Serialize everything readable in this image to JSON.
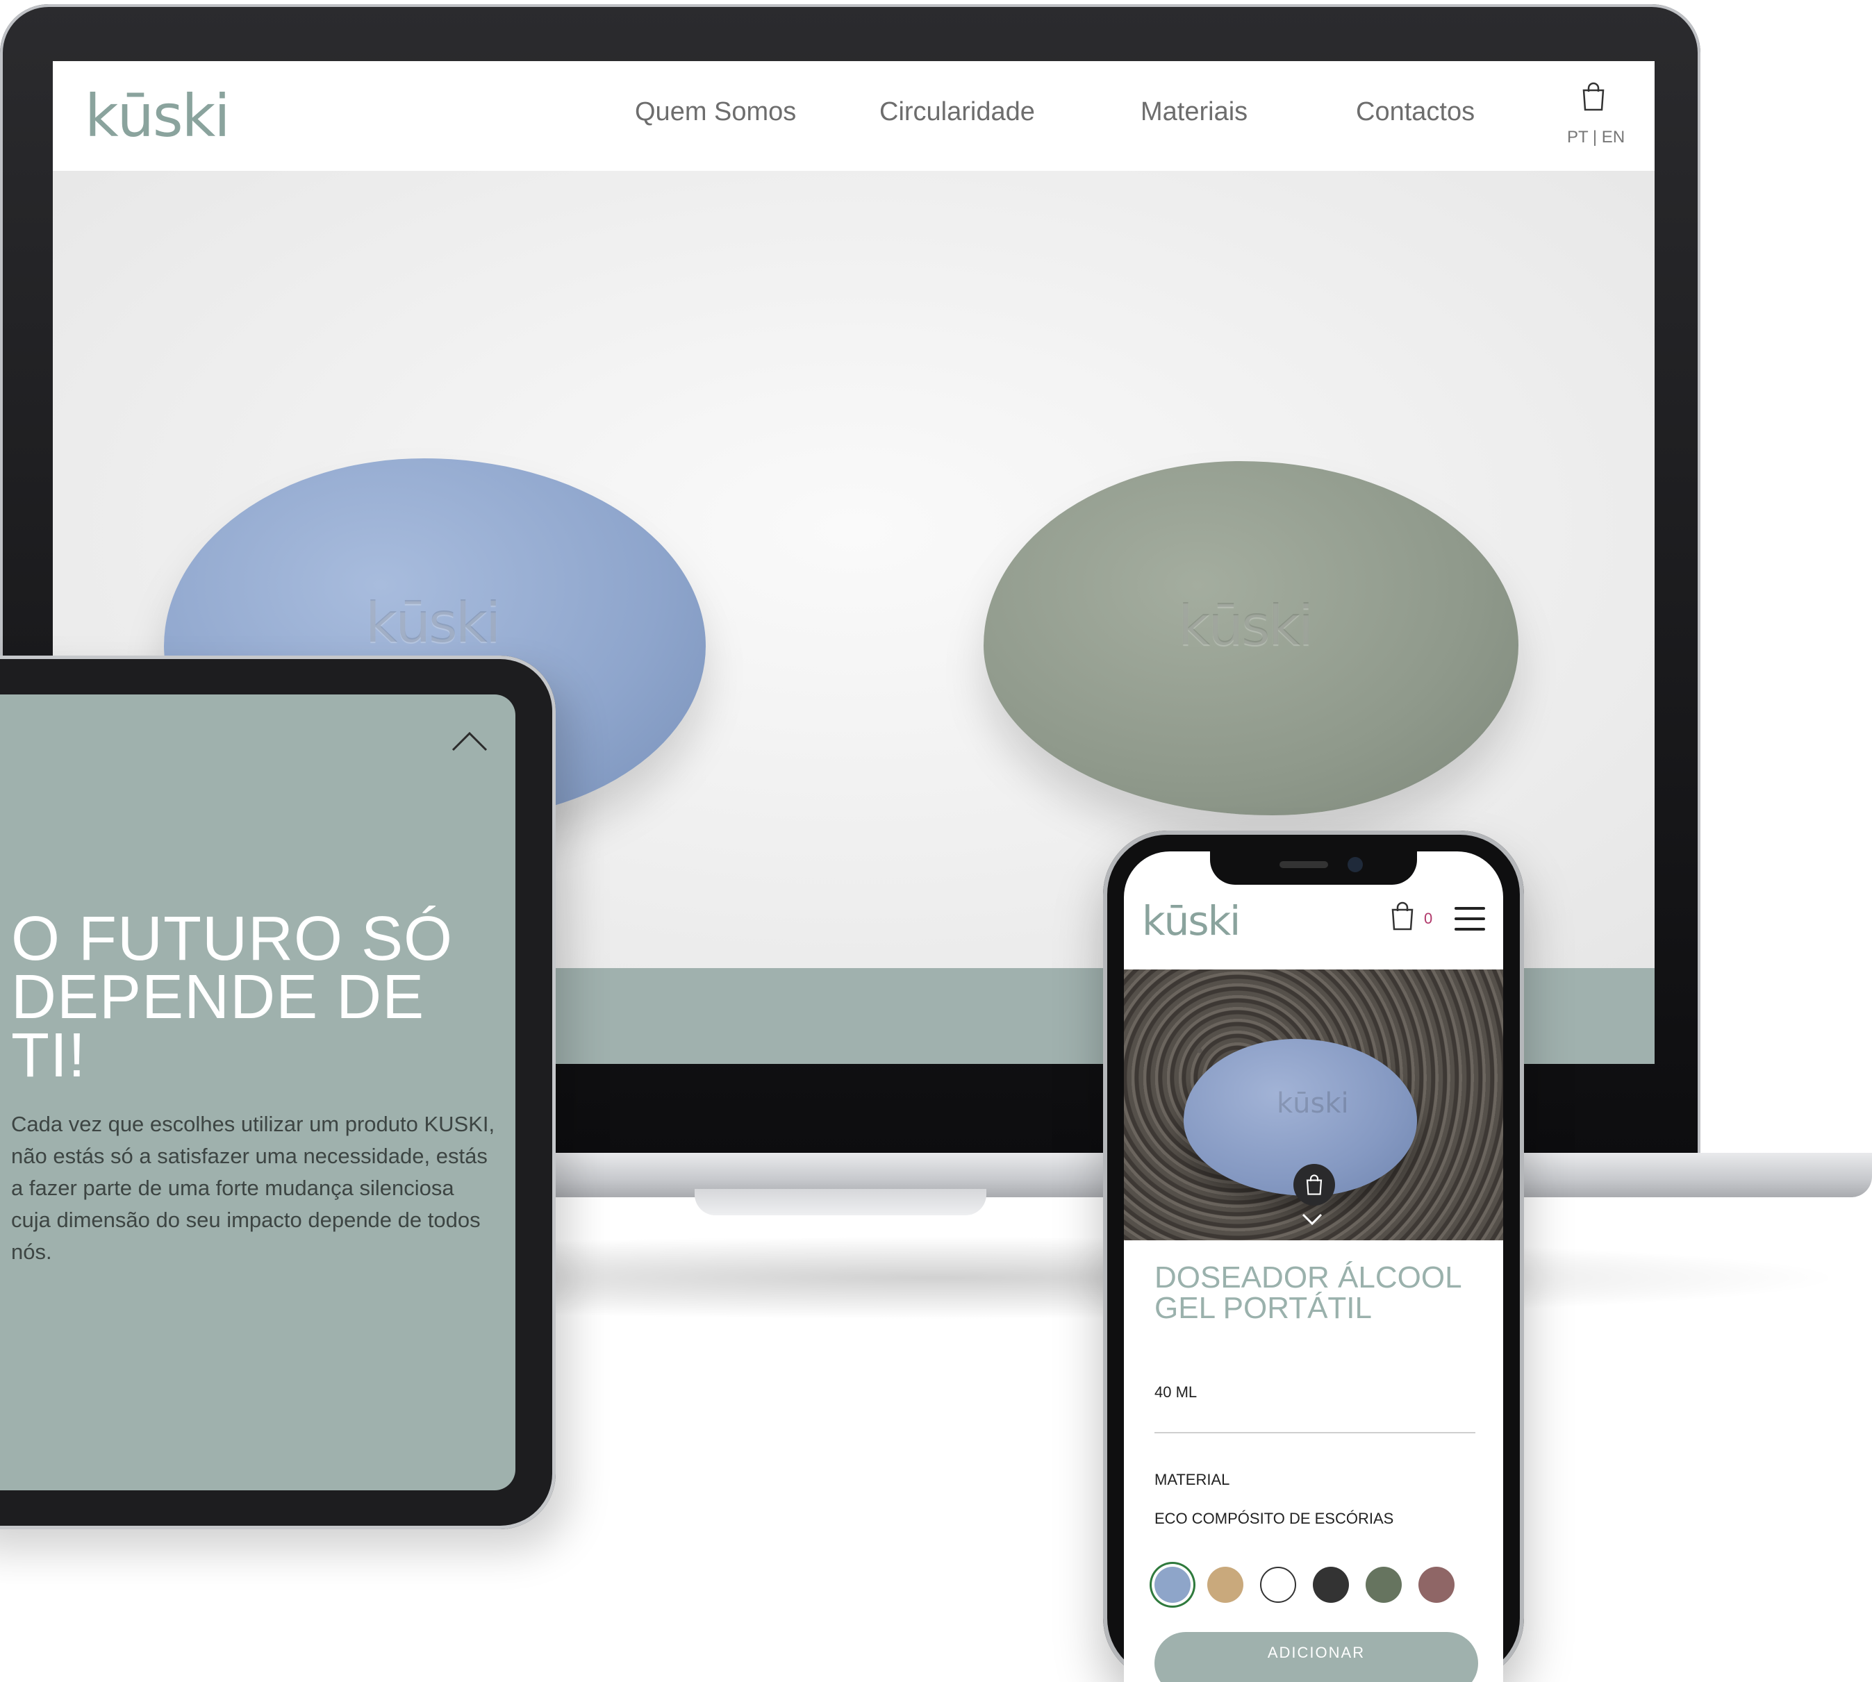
{
  "colors": {
    "brand_sage": "#9fb1ad",
    "logo_sage": "#8aa39d",
    "pebble_blue": "#8ea5cc",
    "pebble_green": "#8f998b",
    "cart_count": "#b0386a"
  },
  "desktop": {
    "logo": "kūski",
    "nav": [
      "Quem Somos",
      "Circularidade",
      "Materiais",
      "Contactos"
    ],
    "cart_icon": "shopping-bag-icon",
    "language": "PT | EN",
    "hero_emboss": "kūski",
    "carousel": {
      "slides": 5,
      "active": 1
    }
  },
  "tablet": {
    "close_icon": "chevron-up-icon",
    "title": "O FUTURO SÓ DEPENDE DE TI!",
    "body": "Cada vez que escolhes utilizar um produto KUSKI, não estás só a satisfazer uma necessidade, estás a fazer parte de uma forte mudança silenciosa cuja dimensão do seu impacto depende de todos nós."
  },
  "mobile": {
    "logo": "kūski",
    "cart_count": "0",
    "menu_icon": "hamburger-menu-icon",
    "product_emboss": "kūski",
    "product_title": "DOSEADOR ÁLCOOL GEL PORTÁTIL",
    "size": "40 ML",
    "material_label": "MATERIAL",
    "material_value": "ECO COMPÓSITO DE ESCÓRIAS",
    "swatches": [
      "#8ea5c9",
      "#c9a97c",
      "#ffffff",
      "#333333",
      "#66745f",
      "#8f6666"
    ],
    "selected_swatch": 0,
    "add_button": "ADICIONAR"
  }
}
